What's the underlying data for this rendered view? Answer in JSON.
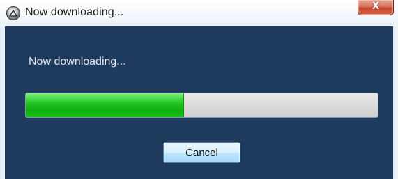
{
  "window": {
    "title": "Now downloading...",
    "app_icon": "app-globe-icon",
    "close_label": "X"
  },
  "dialog": {
    "message": "Now downloading...",
    "progress_fraction": 0.45,
    "cancel_label": "Cancel"
  },
  "colors": {
    "panel_background": "#1e3a5c",
    "progress_fill": "#1bbf1b",
    "progress_track": "#dcdcdc",
    "close_button": "#c4452c"
  }
}
